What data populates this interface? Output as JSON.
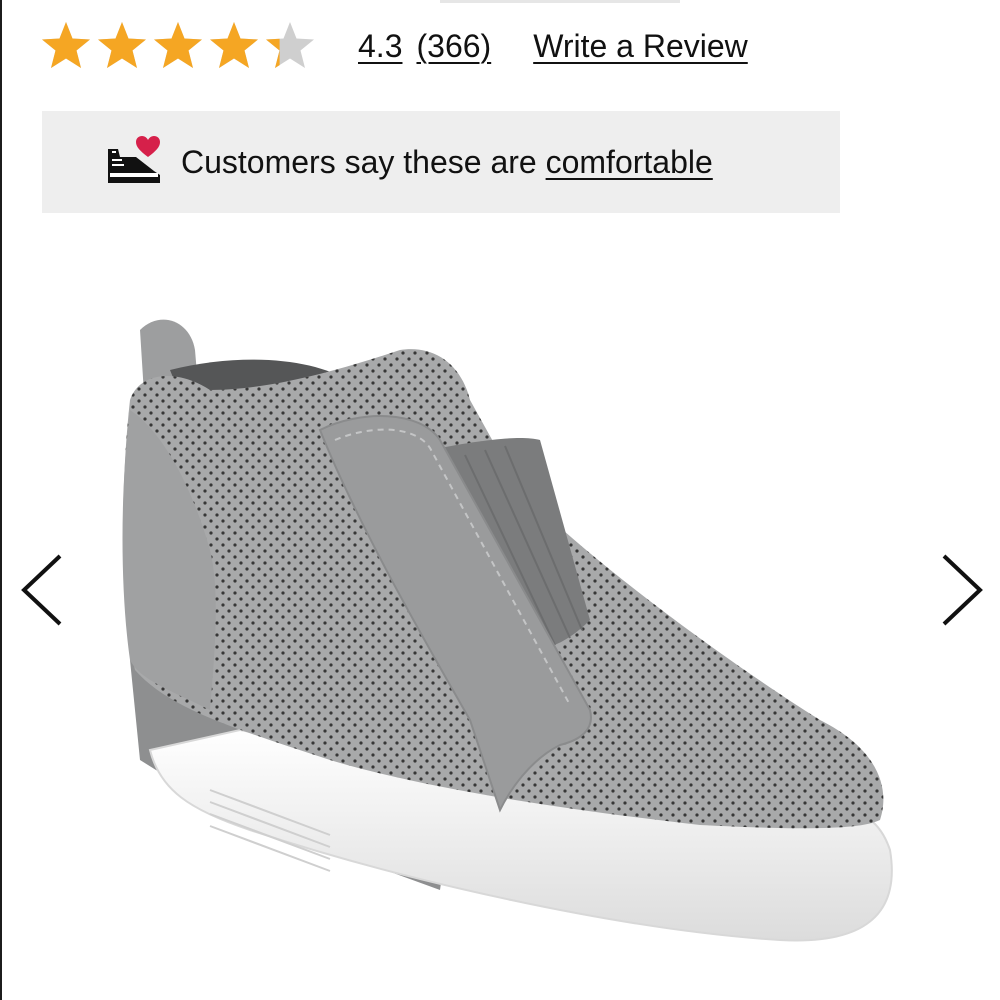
{
  "rating": {
    "value": 4.3,
    "value_text": "4.3",
    "count_text": "(366)",
    "max_stars": 5,
    "star_color": "#f5a623",
    "empty_star_color": "#cfcfcf"
  },
  "write_review_label": "Write a Review",
  "comfort_banner": {
    "text": "Customers say these are ",
    "link": "comfortable",
    "heart_color": "#d6204a"
  },
  "product_image": {
    "icon": "product-shoe-image",
    "upper_color": "#a9aaab",
    "sole_color": "#ffffff"
  },
  "carousel": {
    "prev_icon": "chevron-left-icon",
    "next_icon": "chevron-right-icon"
  }
}
